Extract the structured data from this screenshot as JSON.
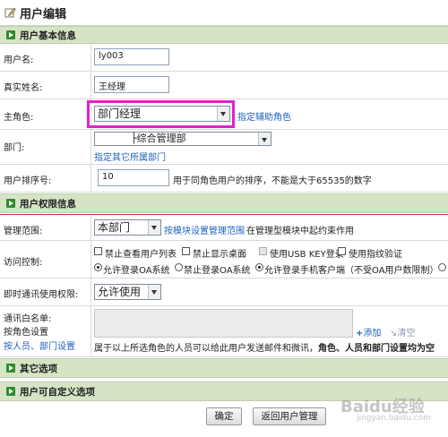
{
  "page_title": "用户编辑",
  "sections": {
    "basic": "用户基本信息",
    "permission": "用户权限信息",
    "other": "其它选项",
    "custom": "用户可自定义选项"
  },
  "basic": {
    "username_label": "用户名:",
    "username_value": "ly003",
    "realname_label": "真实姓名:",
    "realname_value": "王经理",
    "role_label": "主角色:",
    "role_value": "部门经理",
    "role_link": "指定辅助角色",
    "dept_label": "部门:",
    "dept_value": "├综合管理部",
    "dept_link": "指定其它所属部门",
    "sort_label": "用户排序号:",
    "sort_value": "10",
    "sort_hint": "用于同角色用户的排序，不能是大于65535的数字"
  },
  "permission": {
    "scope_label": "管理范围:",
    "scope_value": "本部门",
    "scope_link": "按模块设置管理范围",
    "scope_hint": "在管理型模块中起约束作用",
    "access_label": "访问控制:",
    "checkboxes": [
      "禁止查看用户列表",
      "禁止显示桌面",
      "使用USB KEY登录",
      "使用指纹验证"
    ],
    "radios": [
      "允许登录OA系统",
      "禁止登录OA系统",
      "允许登录手机客户端（不受OA用户数限制）"
    ],
    "im_label": "即时通讯使用权限:",
    "im_value": "允许使用",
    "whitelist_label": "通讯白名单:",
    "whitelist_sub1": "按角色设置",
    "whitelist_sub2": "按人员、部门设置",
    "add_label": "添加",
    "clear_label": "清空",
    "whitelist_note_a": "属于以上所选角色的人员可以给此用户发送邮件和微讯，",
    "whitelist_note_b": "角色、人员和部门设置均为空"
  },
  "buttons": {
    "confirm": "确定",
    "back": "返回用户管理"
  },
  "watermark": "Baidu经验",
  "watermark_url": "jingyan.baidu.com",
  "colors": {
    "section_bg": "#d6e4c6",
    "link": "#1f5fbf",
    "highlight": "#e020d0",
    "icon_green": "#2e8b2e"
  }
}
